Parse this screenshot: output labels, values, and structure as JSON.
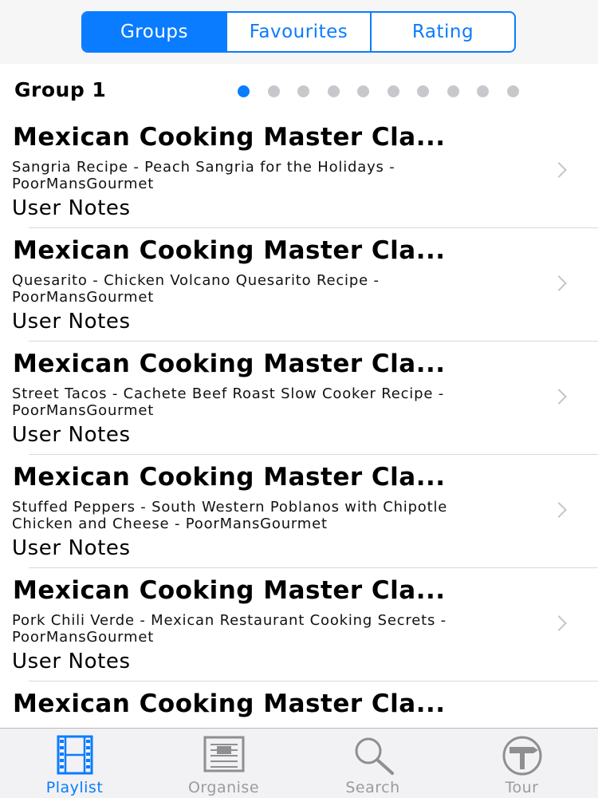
{
  "segments": [
    {
      "label": "Groups",
      "active": true
    },
    {
      "label": "Favourites",
      "active": false
    },
    {
      "label": "Rating",
      "active": false
    }
  ],
  "group_title": "Group 1",
  "pager": {
    "count": 10,
    "active_index": 0
  },
  "rows": [
    {
      "title": "Mexican Cooking Master Cla...",
      "subtitle": "Sangria Recipe - Peach Sangria for the Holidays - PoorMansGourmet",
      "notes": "User Notes"
    },
    {
      "title": "Mexican Cooking Master Cla...",
      "subtitle": "Quesarito - Chicken Volcano Quesarito Recipe - PoorMansGourmet",
      "notes": "User Notes"
    },
    {
      "title": "Mexican Cooking Master Cla...",
      "subtitle": "Street Tacos - Cachete Beef Roast Slow Cooker Recipe - PoorMansGourmet",
      "notes": "User Notes"
    },
    {
      "title": "Mexican Cooking Master Cla...",
      "subtitle": "Stuffed Peppers - South Western Poblanos with Chipotle Chicken and Cheese - PoorMansGourmet",
      "notes": "User Notes"
    },
    {
      "title": "Mexican Cooking Master Cla...",
      "subtitle": "Pork Chili Verde - Mexican Restaurant Cooking Secrets - PoorMansGourmet",
      "notes": "User Notes"
    },
    {
      "title": "Mexican Cooking Master Cla...",
      "subtitle": "",
      "notes": ""
    }
  ],
  "tabs": [
    {
      "label": "Playlist",
      "icon": "film-strip-icon",
      "active": true
    },
    {
      "label": "Organise",
      "icon": "document-list-icon",
      "active": false
    },
    {
      "label": "Search",
      "icon": "magnifier-icon",
      "active": false
    },
    {
      "label": "Tour",
      "icon": "signpost-icon",
      "active": false
    }
  ],
  "colors": {
    "accent": "#0a7cff",
    "inactive": "#9a9aa0",
    "separator": "#d9d9dd"
  }
}
